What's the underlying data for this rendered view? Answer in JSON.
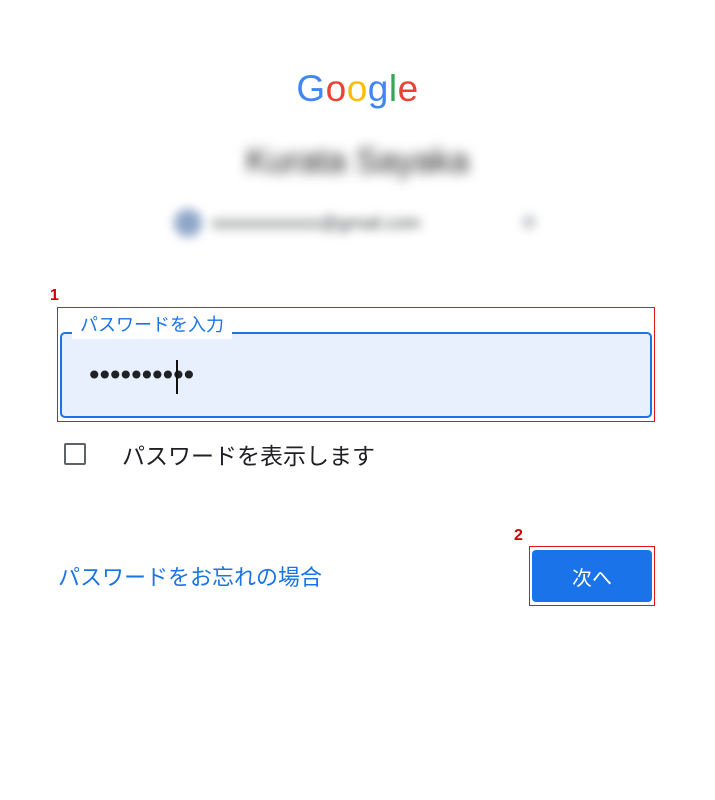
{
  "logo": {
    "letters": [
      "G",
      "o",
      "o",
      "g",
      "l",
      "e"
    ],
    "colors": [
      "#4285F4",
      "#EA4335",
      "#FBBC05",
      "#4285F4",
      "#34A853",
      "#EA4335"
    ]
  },
  "account": {
    "name": "Kurata Sayaka",
    "email": "xxxxxxxxxxxx@gmail.com",
    "avatar_icon": "avatar-icon",
    "chevron_icon": "chevron-down-icon"
  },
  "password_field": {
    "label": "パスワードを入力",
    "value": "••••••••••"
  },
  "show_password": {
    "label": "パスワードを表示します",
    "checked": false
  },
  "forgot_link": "パスワードをお忘れの場合",
  "next_button": "次へ",
  "annotations": {
    "marker_1": "1",
    "marker_2": "2",
    "highlight_color": "#e6141b"
  },
  "colors": {
    "accent": "#1a73e8",
    "field_bg": "#e8f0fe"
  }
}
